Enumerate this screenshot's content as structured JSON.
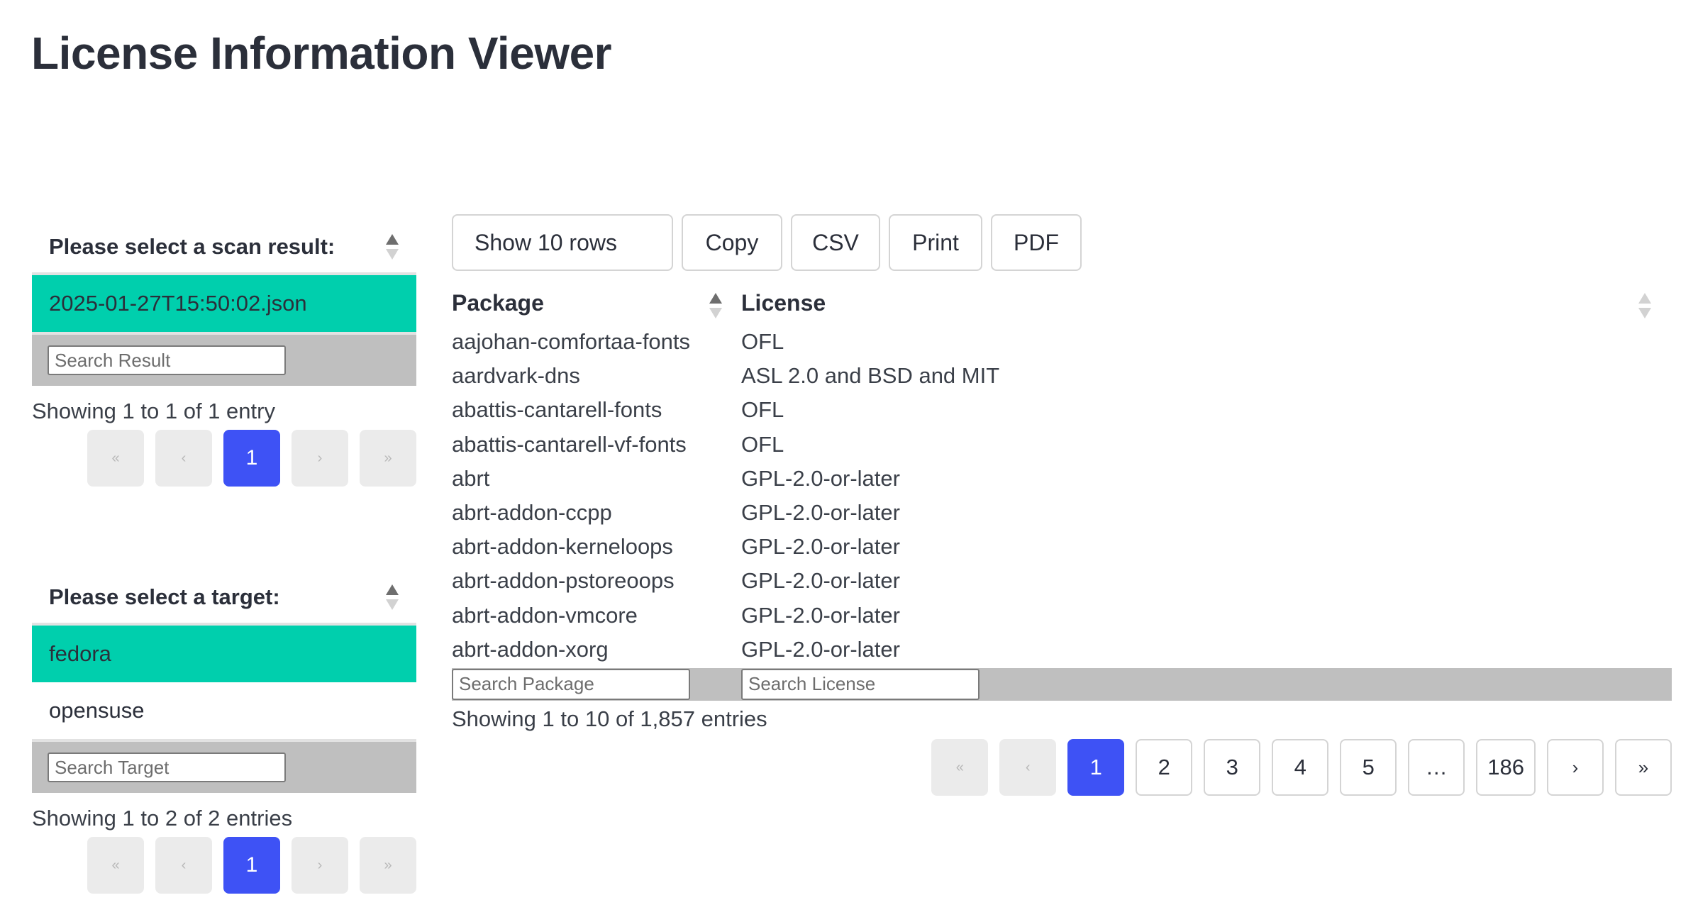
{
  "page": {
    "title": "License Information Viewer"
  },
  "scan_panel": {
    "header": "Please select a scan result:",
    "items": [
      {
        "label": "2025-01-27T15:50:02.json",
        "selected": true
      }
    ],
    "search_placeholder": "Search Result",
    "info": "Showing 1 to 1 of 1 entry",
    "pager": {
      "first": "«",
      "prev": "‹",
      "current": "1",
      "next": "›",
      "last": "»"
    }
  },
  "target_panel": {
    "header": "Please select a target:",
    "items": [
      {
        "label": "fedora",
        "selected": true
      },
      {
        "label": "opensuse",
        "selected": false
      }
    ],
    "search_placeholder": "Search Target",
    "info": "Showing 1 to 2 of 2 entries",
    "pager": {
      "first": "«",
      "prev": "‹",
      "current": "1",
      "next": "›",
      "last": "»"
    }
  },
  "toolbar": {
    "show_rows": "Show 10 rows",
    "copy": "Copy",
    "csv": "CSV",
    "print": "Print",
    "pdf": "PDF"
  },
  "table": {
    "columns": [
      "Package",
      "License"
    ],
    "rows": [
      [
        "aajohan-comfortaa-fonts",
        "OFL"
      ],
      [
        "aardvark-dns",
        "ASL 2.0 and BSD and MIT"
      ],
      [
        "abattis-cantarell-fonts",
        "OFL"
      ],
      [
        "abattis-cantarell-vf-fonts",
        "OFL"
      ],
      [
        "abrt",
        "GPL-2.0-or-later"
      ],
      [
        "abrt-addon-ccpp",
        "GPL-2.0-or-later"
      ],
      [
        "abrt-addon-kerneloops",
        "GPL-2.0-or-later"
      ],
      [
        "abrt-addon-pstoreoops",
        "GPL-2.0-or-later"
      ],
      [
        "abrt-addon-vmcore",
        "GPL-2.0-or-later"
      ],
      [
        "abrt-addon-xorg",
        "GPL-2.0-or-later"
      ]
    ],
    "search_package_placeholder": "Search Package",
    "search_license_placeholder": "Search License",
    "info": "Showing 1 to 10 of 1,857 entries",
    "pager": {
      "first": "«",
      "prev": "‹",
      "pages": [
        "1",
        "2",
        "3",
        "4",
        "5",
        "…",
        "186"
      ],
      "current": "1",
      "next": "›",
      "last": "»"
    }
  },
  "colors": {
    "selected_row": "#00cfad",
    "active_page": "#3e52f5",
    "search_bar": "#bfbfbf",
    "disabled_button": "#ebebeb"
  },
  "icons": {
    "sort": "sort-arrows-icon"
  }
}
